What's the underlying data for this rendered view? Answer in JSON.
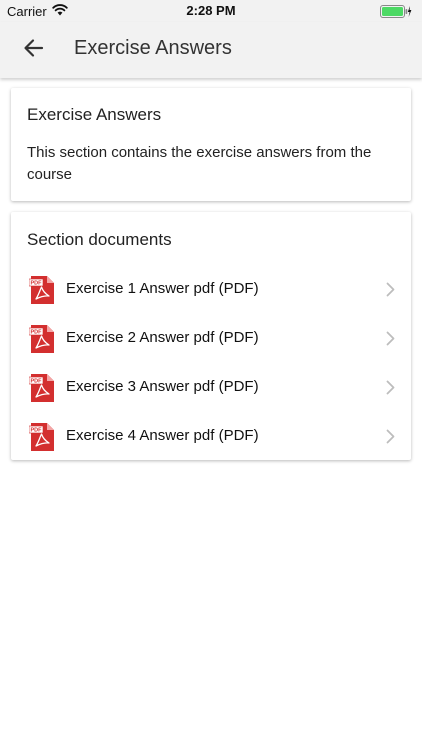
{
  "status_bar": {
    "carrier": "Carrier",
    "time": "2:28 PM",
    "icons": [
      "wifi-icon",
      "battery-icon"
    ]
  },
  "app_bar": {
    "back_icon": "arrow-left-icon",
    "title": "Exercise Answers"
  },
  "info_card": {
    "title": "Exercise Answers",
    "description": "This section contains the exercise answers from the course"
  },
  "documents_card": {
    "title": "Section documents",
    "items": [
      {
        "label": "Exercise 1 Answer pdf (PDF)",
        "icon": "pdf-icon"
      },
      {
        "label": "Exercise 2 Answer pdf (PDF)",
        "icon": "pdf-icon"
      },
      {
        "label": "Exercise 3 Answer pdf (PDF)",
        "icon": "pdf-icon"
      },
      {
        "label": "Exercise 4 Answer pdf (PDF)",
        "icon": "pdf-icon"
      }
    ]
  },
  "colors": {
    "app_bar_bg": "#f2f2f2",
    "pdf_red": "#d32f2f",
    "battery_green": "#4cd964"
  }
}
